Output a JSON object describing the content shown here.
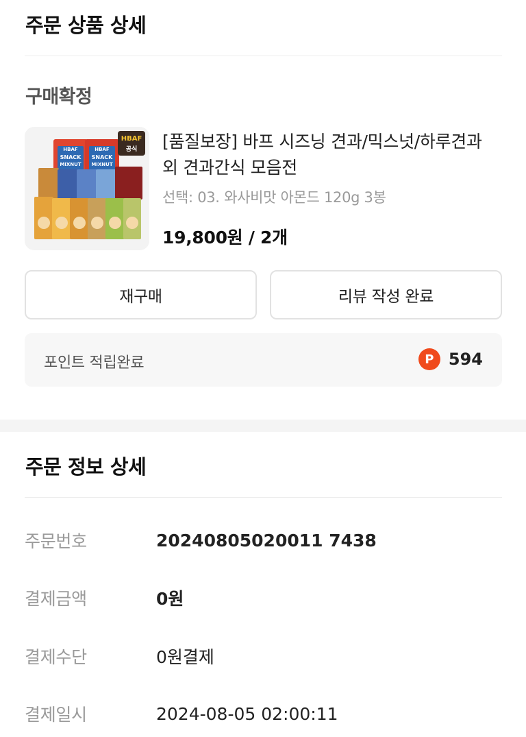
{
  "order_product_section": {
    "title": "주문 상품 상세",
    "status": "구매확정",
    "product": {
      "name": "[품질보장] 바프 시즈닝 견과/믹스넛/하루견과 외 견과간식 모음전",
      "option": "선택: 03. 와사비맛 아몬드 120g 3봉",
      "price": "19,800원 / 2개",
      "thumbnail_badge": [
        "HBAF",
        "공식"
      ],
      "thumbnail_pack_text": [
        "HBAF",
        "SNACK",
        "MIXNUT"
      ]
    },
    "buttons": {
      "rebuy": "재구매",
      "review": "리뷰 작성 완료"
    },
    "points": {
      "label": "포인트 적립완료",
      "icon_letter": "P",
      "icon_color": "#f04a1c",
      "value": "594"
    }
  },
  "order_info_section": {
    "title": "주문 정보 상세",
    "rows": [
      {
        "label": "주문번호",
        "value": "20240805020011 7438"
      },
      {
        "label": "결제금액",
        "value": "0원"
      },
      {
        "label": "결제수단",
        "value": "0원결제"
      },
      {
        "label": "결제일시",
        "value": "2024-08-05 02:00:11"
      }
    ]
  }
}
